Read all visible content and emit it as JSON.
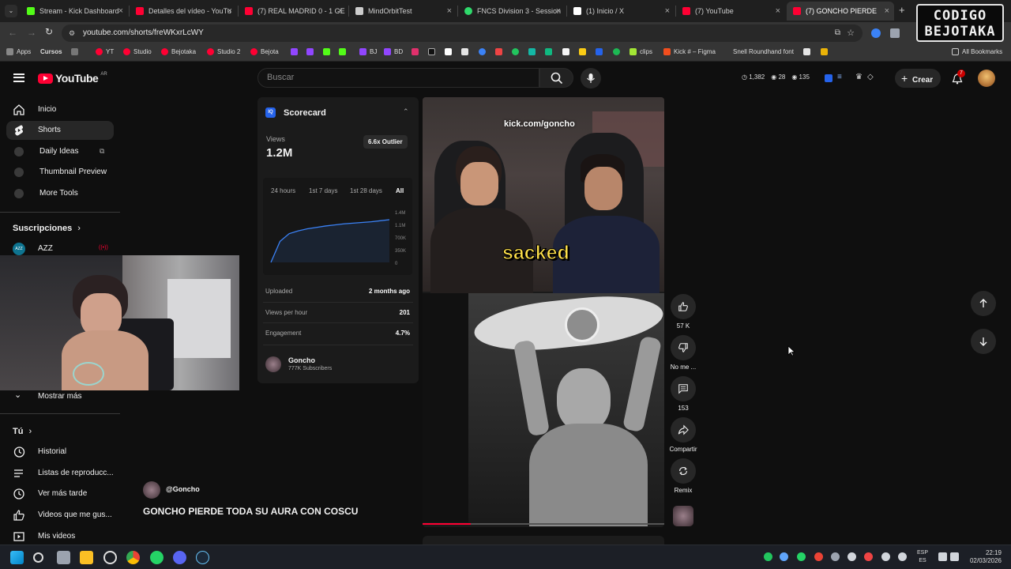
{
  "browser": {
    "tabs": [
      {
        "title": "Stream - Kick Dashboard",
        "color": "#53fc18"
      },
      {
        "title": "Detalles del vídeo - YouTu",
        "color": "#ff0033"
      },
      {
        "title": "(7) REAL MADRID 0 - 1 GE",
        "color": "#ff0033"
      },
      {
        "title": "MindOrbitTest",
        "color": "#cccccc"
      },
      {
        "title": "FNCS Division 3 - Session",
        "color": "#2fd96b"
      },
      {
        "title": "(1) Inicio / X",
        "color": "#ffffff"
      },
      {
        "title": "(7) YouTube",
        "color": "#ff0033"
      },
      {
        "title": "(7) GONCHO PIERDE",
        "color": "#ff0033"
      }
    ],
    "url": "youtube.com/shorts/freWKxrLcWY",
    "bookmarks": {
      "apps": "Apps",
      "cursos": "Cursos",
      "yt": "YT",
      "studio": "Studio",
      "bejotaka": "Bejotaka",
      "studio2": "Studio 2",
      "bejota": "Bejota",
      "bj": "BJ",
      "bd": "BD",
      "clips": "clips",
      "kick_figma": "Kick # – Figma",
      "snell": "Snell Roundhand font",
      "all": "All Bookmarks"
    }
  },
  "overlay": {
    "logo_line1": "CODIGO",
    "logo_line2": "BEJOTAKA"
  },
  "youtube": {
    "logo": "YouTube",
    "region": "AR",
    "search_placeholder": "Buscar",
    "header_stats": {
      "a": "1,382",
      "b": "28",
      "c": "135"
    },
    "create_label": "Crear",
    "notif_count": "7",
    "sidebar": {
      "inicio": "Inicio",
      "shorts": "Shorts",
      "daily_ideas": "Daily Ideas",
      "thumbnail_preview": "Thumbnail Preview",
      "more_tools": "More Tools",
      "subs_heading": "Suscripciones",
      "sub_azz": "AZZ",
      "show_more": "Mostrar más",
      "tu_heading": "Tú",
      "historial": "Historial",
      "listas": "Listas de reproducc...",
      "ver_mas_tarde": "Ver más tarde",
      "videos_gusta": "Videos que me gus...",
      "mis_videos": "Mis videos"
    },
    "scorecard": {
      "title": "Scorecard",
      "views_label": "Views",
      "views_value": "1.2M",
      "outlier": "6.6x Outlier",
      "ranges": [
        "24 hours",
        "1st 7 days",
        "1st 28 days",
        "All"
      ],
      "y_ticks": [
        "1.4M",
        "1.1M",
        "700K",
        "350K",
        "0"
      ],
      "chart_values": [
        0,
        600,
        820,
        900,
        960,
        1000,
        1040,
        1070,
        1100,
        1120,
        1140,
        1160,
        1190,
        1220
      ],
      "uploaded_label": "Uploaded",
      "uploaded_value": "2 months ago",
      "vph_label": "Views per hour",
      "vph_value": "201",
      "engagement_label": "Engagement",
      "engagement_value": "4.7%",
      "channel": "Goncho",
      "subscribers": "777K Subscribers"
    },
    "video": {
      "watermark": "kick.com/goncho",
      "caption": "sacked",
      "channel_handle": "@Goncho",
      "title": "GONCHO PIERDE TODA SU AURA CON COSCU"
    },
    "actions": {
      "likes": "57 K",
      "dislike": "No me ...",
      "comments": "153",
      "share": "Compartir",
      "remix": "Remix"
    }
  },
  "taskbar": {
    "lang1": "ESP",
    "lang2": "ES",
    "time": "22:19",
    "date": "02/03/2026"
  }
}
